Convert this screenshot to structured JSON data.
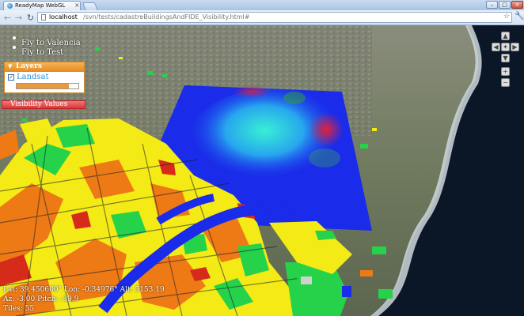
{
  "browser": {
    "tab_title": "ReadyMap WebGL",
    "tab_close": "×",
    "new_tab": "",
    "window_minimize": "–",
    "window_maximize": "□",
    "window_close": "×",
    "nav_back": "←",
    "nav_forward": "→",
    "nav_reload": "↻",
    "url_host": "localhost",
    "url_path": "/svn/tests/cadastreBuildingsAndFIDE_Visibility.html#",
    "bookmark_star": "☆",
    "menu_wrench": "🔧"
  },
  "map": {
    "fly_links": [
      "Fly to Valencia",
      "Fly to Test"
    ],
    "layers_panel": {
      "title": "Layers",
      "collapse_arrow": "▼",
      "layer_name": "Landsat",
      "checked_mark": "✓",
      "opacity": 0.85
    },
    "visibility_label": "Visibility Values",
    "nav_controls": {
      "up": "▲",
      "down": "▼",
      "left": "◀",
      "right": "▶",
      "center": "✦",
      "zoom_in": "+",
      "zoom_out": "−"
    },
    "readout": {
      "line1": "Lat: 39.450600° Lon: -0.34976° Alt: 5153.19",
      "line2": "Az: -3.00 Pitch: -39.9",
      "line3": "Tiles: 55"
    },
    "colors": {
      "sea": "#0b1626",
      "surf": "#cfd7dc",
      "visibility_blue": "#1a2bea",
      "visibility_cyan": "#33e0d8",
      "building_yellow": "#f4ea16",
      "building_orange": "#ee7a16",
      "building_green": "#26d24a",
      "building_red": "#d62a1a",
      "panel_orange": "#e68a1c",
      "link_blue": "#2a8fd8"
    }
  }
}
